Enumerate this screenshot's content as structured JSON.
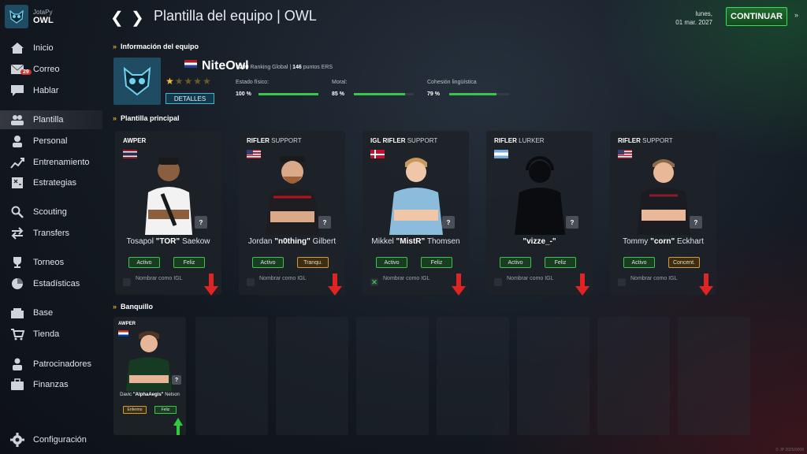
{
  "app": {
    "small": "JotaPy",
    "big": "OWL"
  },
  "header": {
    "title": "Plantilla del equipo | OWL",
    "day": "lunes,",
    "date": "01 mar. 2027",
    "continue": "CONTINUAR",
    "continue_arrow": "»"
  },
  "sidebar": {
    "mail_badge": "29",
    "items": [
      {
        "label": "Inicio",
        "icon": "home-icon"
      },
      {
        "label": "Correo",
        "icon": "mail-icon"
      },
      {
        "label": "Hablar",
        "icon": "chat-icon"
      },
      {
        "label": "Plantilla",
        "icon": "team-icon"
      },
      {
        "label": "Personal",
        "icon": "person-icon"
      },
      {
        "label": "Entrenamiento",
        "icon": "chart-icon"
      },
      {
        "label": "Estrategias",
        "icon": "strategy-icon"
      },
      {
        "label": "Scouting",
        "icon": "search-icon"
      },
      {
        "label": "Transfers",
        "icon": "transfer-icon"
      },
      {
        "label": "Torneos",
        "icon": "trophy-icon"
      },
      {
        "label": "Estadísticas",
        "icon": "pie-icon"
      },
      {
        "label": "Base",
        "icon": "base-icon"
      },
      {
        "label": "Tienda",
        "icon": "cart-icon"
      },
      {
        "label": "Patrocinadores",
        "icon": "sponsor-icon"
      },
      {
        "label": "Finanzas",
        "icon": "briefcase-icon"
      },
      {
        "label": "Configuración",
        "icon": "gear-icon"
      }
    ]
  },
  "team_info": {
    "heading": "Información del equipo",
    "name": "NiteOwl",
    "rank_num": "#200",
    "rank_text": "Ranking Global |",
    "points_num": "146",
    "points_text": "puntos ERS",
    "stars_rating": 0.5,
    "details": "DETALLES",
    "stats": [
      {
        "label": "Estado físico:",
        "value": "100 %",
        "fraction": 1.0
      },
      {
        "label": "Moral:",
        "value": "85 %",
        "fraction": 0.85
      },
      {
        "label": "Cohesión lingüística",
        "value": "79 %",
        "fraction": 0.79
      }
    ]
  },
  "roster": {
    "heading": "Plantilla principal",
    "igl_label": "Nombrar como IGL",
    "players": [
      {
        "role1": "AWPER",
        "role2": "",
        "igl": "",
        "first": "Tosapol",
        "nick": "\"TOR\"",
        "last": "Saekow",
        "status": "Activo",
        "mood": "Feliz",
        "mood_color": "green",
        "flag": "thailand",
        "igl_checked": false
      },
      {
        "role1": "RIFLER",
        "role2": "SUPPORT",
        "igl": "",
        "first": "Jordan",
        "nick": "\"n0thing\"",
        "last": "Gilbert",
        "status": "Activo",
        "mood": "Tranqu.",
        "mood_color": "orange",
        "flag": "usa",
        "igl_checked": false
      },
      {
        "role1": "RIFLER",
        "role2": "SUPPORT",
        "igl": "IGL",
        "first": "Mikkel",
        "nick": "\"MistR\"",
        "last": "Thomsen",
        "status": "Activo",
        "mood": "Feliz",
        "mood_color": "green",
        "flag": "denmark",
        "igl_checked": true
      },
      {
        "role1": "RIFLER",
        "role2": "LURKER",
        "igl": "",
        "first": "",
        "nick": "\"vizze_-\"",
        "last": "",
        "status": "Activo",
        "mood": "Feliz",
        "mood_color": "green",
        "flag": "argentina",
        "igl_checked": false
      },
      {
        "role1": "RIFLER",
        "role2": "SUPPORT",
        "igl": "",
        "first": "Tommy",
        "nick": "\"corn\"",
        "last": "Eckhart",
        "status": "Activo",
        "mood": "Concent.",
        "mood_color": "orange",
        "flag": "usa",
        "igl_checked": false
      }
    ]
  },
  "bench": {
    "heading": "Banquillo",
    "player": {
      "role": "AWPER",
      "first": "Davic",
      "nick": "\"AlphaAegis\"",
      "last": "Nelson",
      "status": "Enfermo",
      "mood": "Feliz",
      "flag": "paraguay"
    }
  },
  "footer": "© JP 2025/0008"
}
